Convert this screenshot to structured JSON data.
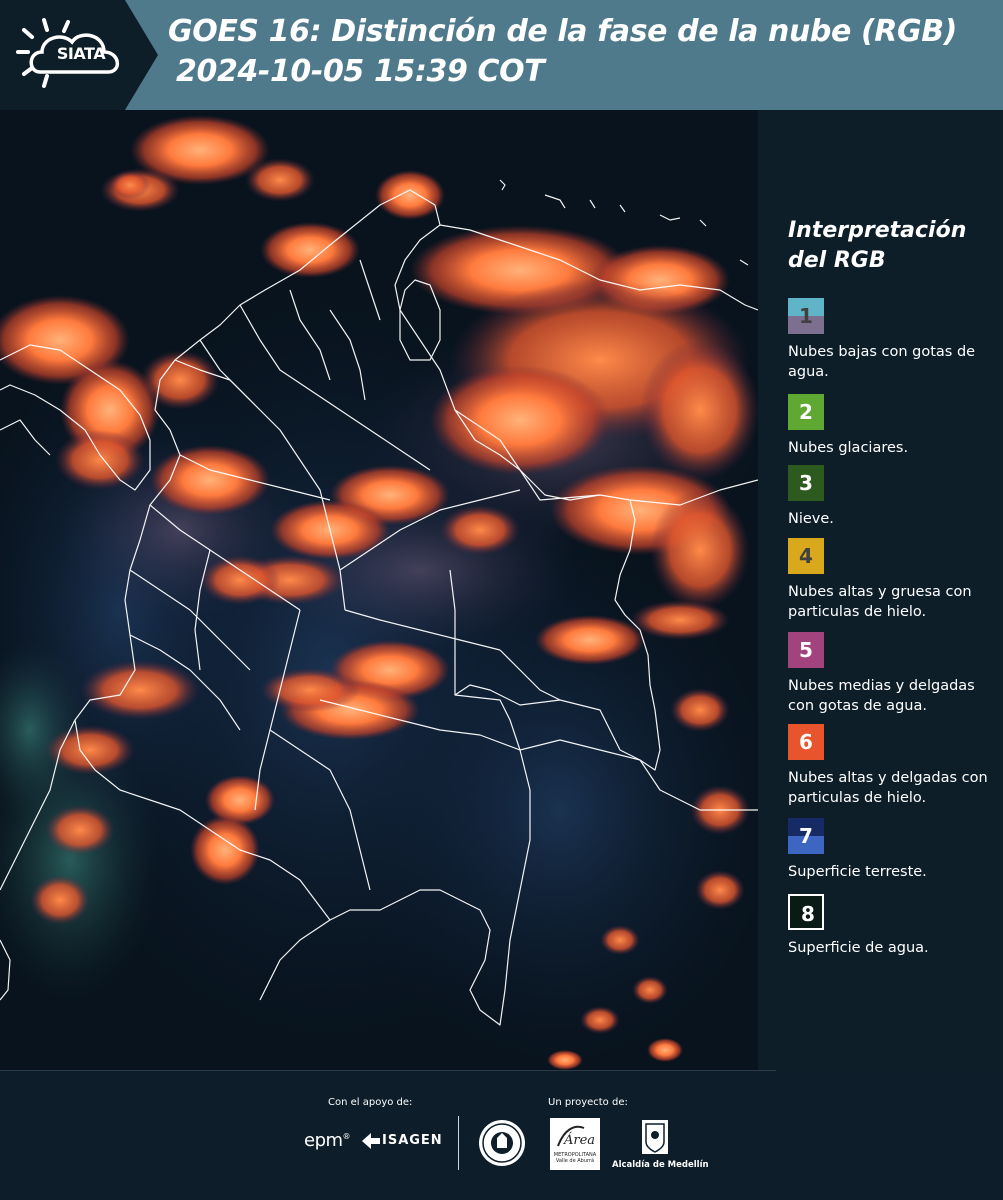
{
  "header": {
    "logo_text": "SIATA",
    "title_line1": "GOES 16: Distinción de la fase de la nube (RGB)",
    "title_line2": "2024-10-05 15:39 COT"
  },
  "legend": {
    "title": "Interpretación del RGB",
    "items": [
      {
        "number": "1",
        "description": "Nubes bajas con gotas de agua.",
        "color_top": "#5fb5c7",
        "color_bottom": "#7d6f8f",
        "text_color": "#404040"
      },
      {
        "number": "2",
        "description": "Nubes glaciares.",
        "color": "#5fa832",
        "text_color": "#ffffff"
      },
      {
        "number": "3",
        "description": "Nieve.",
        "color": "#2d5a1f",
        "text_color": "#ffffff"
      },
      {
        "number": "4",
        "description": "Nubes altas y gruesa con particulas de hielo.",
        "color": "#d9a81c",
        "text_color": "#404040"
      },
      {
        "number": "5",
        "description": "Nubes medias y delgadas con gotas de agua.",
        "color": "#a2437e",
        "text_color": "#ffffff"
      },
      {
        "number": "6",
        "description": "Nubes altas y delgadas con particulas de hielo.",
        "color": "#e8542c",
        "text_color": "#ffffff"
      },
      {
        "number": "7",
        "description": "Superficie terreste.",
        "color_top": "#162a66",
        "color_bottom": "#3c66c2",
        "text_color": "#ffffff"
      },
      {
        "number": "8",
        "description": "Superficie de agua.",
        "color": "#0a1a14",
        "text_color": "#ffffff",
        "border": "#ffffff"
      }
    ]
  },
  "footer": {
    "support_label": "Con el apoyo de:",
    "project_label": "Un proyecto de:",
    "epm": "epm",
    "epm_mark": "®",
    "isagen": "ISAGEN",
    "area_metro_title": "Área",
    "area_metro_sub": "METROPOLITANA Valle de Aburrá",
    "alcaldia": "Alcaldía de Medellín"
  },
  "icons": {
    "logo": "sun-cloud-icon",
    "isagen": "isagen-arrow-icon",
    "university": "university-seal-icon",
    "alcaldia": "coat-of-arms-icon"
  }
}
